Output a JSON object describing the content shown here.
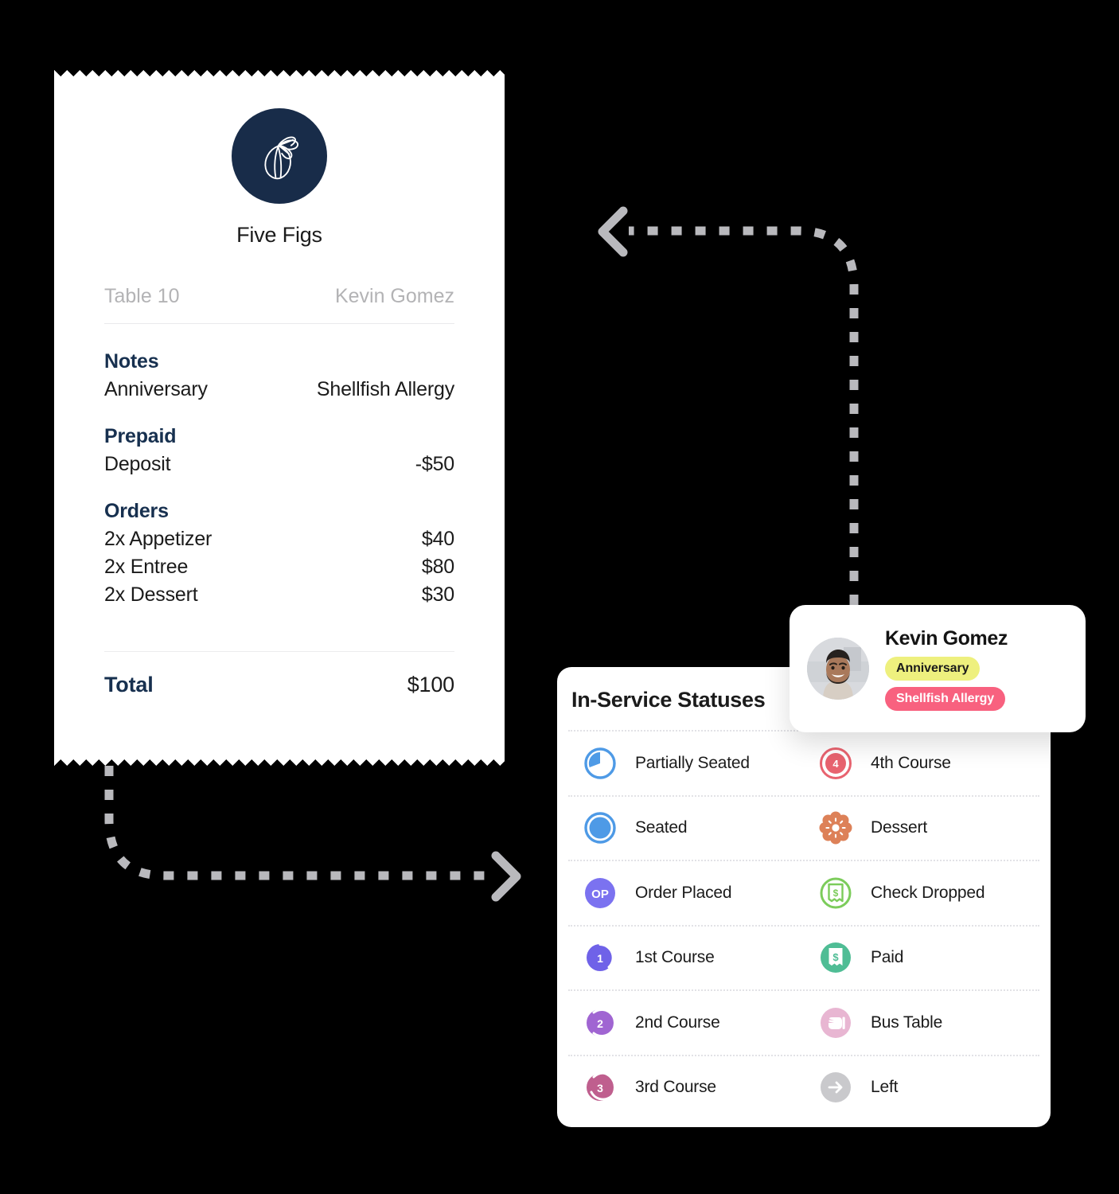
{
  "receipt": {
    "logo_icon": "fig-logo-icon",
    "brand": "Five Figs",
    "table": "Table 10",
    "guest": "Kevin Gomez",
    "sections": [
      {
        "heading": "Notes",
        "rows": [
          {
            "label": "Anniversary",
            "value": "Shellfish Allergy"
          }
        ]
      },
      {
        "heading": "Prepaid",
        "rows": [
          {
            "label": "Deposit",
            "value": "-$50"
          }
        ]
      },
      {
        "heading": "Orders",
        "rows": [
          {
            "label": "2x Appetizer",
            "value": "$40"
          },
          {
            "label": "2x Entree",
            "value": "$80"
          },
          {
            "label": "2x Dessert",
            "value": "$30"
          }
        ]
      }
    ],
    "total_label": "Total",
    "total_value": "$100"
  },
  "status_card": {
    "title": "In-Service Statuses",
    "rows": [
      {
        "left": {
          "label": "Partially Seated",
          "icon": "partially-seated-icon",
          "color": "#4e9ae6"
        },
        "right": {
          "label": "4th Course",
          "icon": "course-4-icon",
          "color": "#e8636f"
        }
      },
      {
        "left": {
          "label": "Seated",
          "icon": "seated-icon",
          "color": "#4e9ae6"
        },
        "right": {
          "label": "Dessert",
          "icon": "dessert-icon",
          "color": "#dd8158"
        }
      },
      {
        "left": {
          "label": "Order Placed",
          "icon": "order-placed-icon",
          "color": "#7b72f0"
        },
        "right": {
          "label": "Check Dropped",
          "icon": "check-dropped-icon",
          "color": "#7ccc5b"
        }
      },
      {
        "left": {
          "label": "1st Course",
          "icon": "course-1-icon",
          "color": "#6f62e8"
        },
        "right": {
          "label": "Paid",
          "icon": "paid-icon",
          "color": "#4fbd95"
        }
      },
      {
        "left": {
          "label": "2nd Course",
          "icon": "course-2-icon",
          "color": "#a065d2"
        },
        "right": {
          "label": "Bus Table",
          "icon": "bus-table-icon",
          "color": "#e8b6d2"
        }
      },
      {
        "left": {
          "label": "3rd Course",
          "icon": "course-3-icon",
          "color": "#bf5f8e"
        },
        "right": {
          "label": "Left",
          "icon": "left-icon",
          "color": "#c9c9cc"
        }
      }
    ],
    "order_placed_initials": "OP",
    "course_numbers": {
      "one": "1",
      "two": "2",
      "three": "3",
      "four": "4"
    }
  },
  "guest_card": {
    "avatar_icon": "guest-avatar-photo",
    "name": "Kevin Gomez",
    "tags": [
      {
        "label": "Anniversary",
        "color": "#eef07e"
      },
      {
        "label": "Shellfish Allergy",
        "color": "#f8617f"
      }
    ]
  },
  "arrows": {
    "top_arrow": "arrow-guest-to-receipt",
    "bottom_arrow": "arrow-receipt-to-statuses",
    "color": "#b9b9bd"
  }
}
